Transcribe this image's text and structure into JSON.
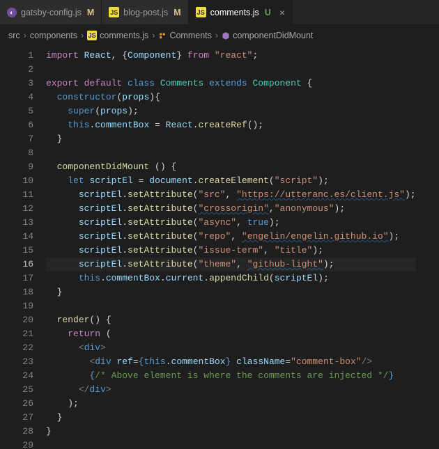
{
  "tabs": [
    {
      "icon": "gatsby",
      "label": "gatsby-config.js",
      "badge": "M",
      "active": false,
      "close": true
    },
    {
      "icon": "js",
      "label": "blog-post.js",
      "badge": "M",
      "active": false,
      "close": true
    },
    {
      "icon": "js",
      "label": "comments.js",
      "badge": "U",
      "active": true,
      "close": true
    }
  ],
  "breadcrumb": {
    "parts": [
      {
        "type": "text",
        "text": "src"
      },
      {
        "type": "text",
        "text": "components"
      },
      {
        "type": "js",
        "text": "comments.js"
      },
      {
        "type": "class",
        "text": "Comments"
      },
      {
        "type": "method",
        "text": "componentDidMount"
      }
    ],
    "sep": "›"
  },
  "active_line": 16,
  "lines": [
    {
      "n": 1,
      "seg": [
        [
          "kw",
          "import "
        ],
        [
          "var",
          "React"
        ],
        [
          "punct",
          ", {"
        ],
        [
          "var",
          "Component"
        ],
        [
          "punct",
          "} "
        ],
        [
          "kw",
          "from "
        ],
        [
          "str",
          "\"react\""
        ],
        [
          "punct",
          ";"
        ]
      ]
    },
    {
      "n": 2,
      "seg": [
        [
          "",
          ""
        ]
      ]
    },
    {
      "n": 3,
      "seg": [
        [
          "kw",
          "export default "
        ],
        [
          "kw2",
          "class "
        ],
        [
          "cls",
          "Comments "
        ],
        [
          "kw2",
          "extends "
        ],
        [
          "cls",
          "Component"
        ],
        [
          "punct",
          " {"
        ]
      ]
    },
    {
      "n": 4,
      "seg": [
        [
          "",
          "  "
        ],
        [
          "kw2",
          "constructor"
        ],
        [
          "punct",
          "("
        ],
        [
          "var",
          "props"
        ],
        [
          "punct",
          "){"
        ]
      ]
    },
    {
      "n": 5,
      "seg": [
        [
          "",
          "    "
        ],
        [
          "kw2",
          "super"
        ],
        [
          "punct",
          "("
        ],
        [
          "var",
          "props"
        ],
        [
          "punct",
          ");"
        ]
      ]
    },
    {
      "n": 6,
      "seg": [
        [
          "",
          "    "
        ],
        [
          "kw2",
          "this"
        ],
        [
          "punct",
          "."
        ],
        [
          "var",
          "commentBox"
        ],
        [
          "punct",
          " = "
        ],
        [
          "var",
          "React"
        ],
        [
          "punct",
          "."
        ],
        [
          "fn",
          "createRef"
        ],
        [
          "punct",
          "();"
        ]
      ]
    },
    {
      "n": 7,
      "seg": [
        [
          "",
          "  "
        ],
        [
          "punct",
          "}"
        ]
      ]
    },
    {
      "n": 8,
      "seg": [
        [
          "",
          ""
        ]
      ]
    },
    {
      "n": 9,
      "seg": [
        [
          "",
          "  "
        ],
        [
          "fn",
          "componentDidMount"
        ],
        [
          "punct",
          " () {"
        ]
      ]
    },
    {
      "n": 10,
      "seg": [
        [
          "",
          "    "
        ],
        [
          "kw2",
          "let "
        ],
        [
          "var",
          "scriptEl"
        ],
        [
          "punct",
          " = "
        ],
        [
          "var",
          "document"
        ],
        [
          "punct",
          "."
        ],
        [
          "fn",
          "createElement"
        ],
        [
          "punct",
          "("
        ],
        [
          "str",
          "\"script\""
        ],
        [
          "punct",
          ");"
        ]
      ]
    },
    {
      "n": 11,
      "seg": [
        [
          "",
          "      "
        ],
        [
          "var",
          "scriptEl"
        ],
        [
          "punct",
          "."
        ],
        [
          "fn",
          "setAttribute"
        ],
        [
          "punct",
          "("
        ],
        [
          "str",
          "\"src\""
        ],
        [
          "punct",
          ", "
        ],
        [
          "str squiggle",
          "\"https://utteranc.es/client.js\""
        ],
        [
          "punct",
          ");"
        ]
      ]
    },
    {
      "n": 12,
      "seg": [
        [
          "",
          "      "
        ],
        [
          "var",
          "scriptEl"
        ],
        [
          "punct",
          "."
        ],
        [
          "fn",
          "setAttribute"
        ],
        [
          "punct",
          "("
        ],
        [
          "str squiggle",
          "\"crossorigin\""
        ],
        [
          "punct",
          ","
        ],
        [
          "str",
          "\"anonymous\""
        ],
        [
          "punct",
          ");"
        ]
      ]
    },
    {
      "n": 13,
      "seg": [
        [
          "",
          "      "
        ],
        [
          "var",
          "scriptEl"
        ],
        [
          "punct",
          "."
        ],
        [
          "fn",
          "setAttribute"
        ],
        [
          "punct",
          "("
        ],
        [
          "str",
          "\"async\""
        ],
        [
          "punct",
          ", "
        ],
        [
          "bool",
          "true"
        ],
        [
          "punct",
          ");"
        ]
      ]
    },
    {
      "n": 14,
      "seg": [
        [
          "",
          "      "
        ],
        [
          "var",
          "scriptEl"
        ],
        [
          "punct",
          "."
        ],
        [
          "fn",
          "setAttribute"
        ],
        [
          "punct",
          "("
        ],
        [
          "str",
          "\"repo\""
        ],
        [
          "punct",
          ", "
        ],
        [
          "str squiggle",
          "\"engelin/engelin.github.io\""
        ],
        [
          "punct",
          ");"
        ]
      ]
    },
    {
      "n": 15,
      "seg": [
        [
          "",
          "      "
        ],
        [
          "var",
          "scriptEl"
        ],
        [
          "punct",
          "."
        ],
        [
          "fn",
          "setAttribute"
        ],
        [
          "punct",
          "("
        ],
        [
          "str",
          "\"issue-term\""
        ],
        [
          "punct",
          ", "
        ],
        [
          "str",
          "\"title\""
        ],
        [
          "punct",
          ");"
        ]
      ]
    },
    {
      "n": 16,
      "seg": [
        [
          "",
          "      "
        ],
        [
          "var",
          "scriptEl"
        ],
        [
          "punct",
          "."
        ],
        [
          "fn",
          "setAttribute"
        ],
        [
          "punct",
          "("
        ],
        [
          "str",
          "\"theme\""
        ],
        [
          "punct",
          ", "
        ],
        [
          "str squiggle",
          "\"github-light\""
        ],
        [
          "punct",
          ");"
        ]
      ]
    },
    {
      "n": 17,
      "seg": [
        [
          "",
          "      "
        ],
        [
          "kw2",
          "this"
        ],
        [
          "punct",
          "."
        ],
        [
          "var",
          "commentBox"
        ],
        [
          "punct",
          "."
        ],
        [
          "var",
          "current"
        ],
        [
          "punct",
          "."
        ],
        [
          "fn",
          "appendChild"
        ],
        [
          "punct",
          "("
        ],
        [
          "var",
          "scriptEl"
        ],
        [
          "punct",
          ");"
        ]
      ]
    },
    {
      "n": 18,
      "seg": [
        [
          "",
          "  "
        ],
        [
          "punct",
          "}"
        ]
      ]
    },
    {
      "n": 19,
      "seg": [
        [
          "",
          ""
        ]
      ]
    },
    {
      "n": 20,
      "seg": [
        [
          "",
          "  "
        ],
        [
          "fn",
          "render"
        ],
        [
          "punct",
          "() {"
        ]
      ]
    },
    {
      "n": 21,
      "seg": [
        [
          "",
          "    "
        ],
        [
          "kw",
          "return"
        ],
        [
          "punct",
          " ("
        ]
      ]
    },
    {
      "n": 22,
      "seg": [
        [
          "",
          "      "
        ],
        [
          "tagc",
          "<"
        ],
        [
          "tag",
          "div"
        ],
        [
          "tagc",
          ">"
        ]
      ]
    },
    {
      "n": 23,
      "seg": [
        [
          "",
          "        "
        ],
        [
          "tagc",
          "<"
        ],
        [
          "tag",
          "div "
        ],
        [
          "attr",
          "ref"
        ],
        [
          "punct",
          "="
        ],
        [
          "kw2",
          "{"
        ],
        [
          "kw2",
          "this"
        ],
        [
          "punct",
          "."
        ],
        [
          "var",
          "commentBox"
        ],
        [
          "kw2",
          "} "
        ],
        [
          "attr",
          "className"
        ],
        [
          "punct",
          "="
        ],
        [
          "str",
          "\"comment-box\""
        ],
        [
          "tagc",
          "/>"
        ]
      ]
    },
    {
      "n": 24,
      "seg": [
        [
          "",
          "        "
        ],
        [
          "kw2",
          "{"
        ],
        [
          "cmt",
          "/* Above element is where the comments are injected */"
        ],
        [
          "kw2",
          "}"
        ]
      ]
    },
    {
      "n": 25,
      "seg": [
        [
          "",
          "      "
        ],
        [
          "tagc",
          "</"
        ],
        [
          "tag",
          "div"
        ],
        [
          "tagc",
          ">"
        ]
      ]
    },
    {
      "n": 26,
      "seg": [
        [
          "",
          "    "
        ],
        [
          "punct",
          ");"
        ]
      ]
    },
    {
      "n": 27,
      "seg": [
        [
          "",
          "  "
        ],
        [
          "punct",
          "}"
        ]
      ]
    },
    {
      "n": 28,
      "seg": [
        [
          "punct",
          "}"
        ]
      ]
    },
    {
      "n": 29,
      "seg": [
        [
          "",
          ""
        ]
      ]
    }
  ]
}
